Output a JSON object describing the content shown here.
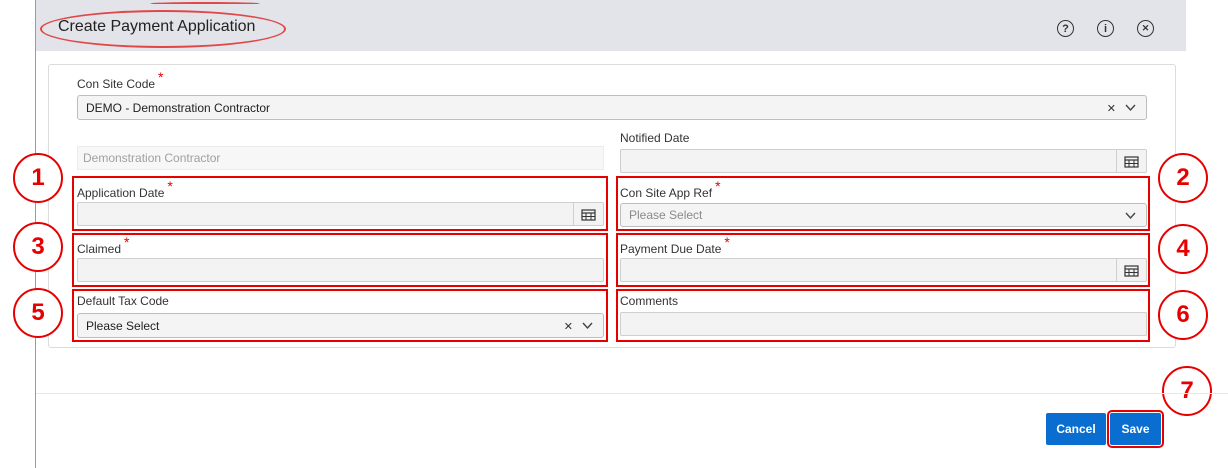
{
  "header": {
    "title": "Create Payment Application",
    "icons": [
      "help-icon",
      "info-icon",
      "close-icon"
    ],
    "help_glyph": "?",
    "info_glyph": "i",
    "close_glyph": "✕"
  },
  "form": {
    "con_site_code": {
      "label": "Con Site Code",
      "required": "*",
      "value": "DEMO - Demonstration Contractor"
    },
    "contractor_name": {
      "value": "Demonstration Contractor"
    },
    "notified_date": {
      "label": "Notified Date",
      "value": ""
    },
    "application_date": {
      "label": "Application Date",
      "required": "*",
      "value": ""
    },
    "con_site_app_ref": {
      "label": "Con Site App Ref",
      "required": "*",
      "placeholder": "Please Select"
    },
    "claimed": {
      "label": "Claimed",
      "required": "*",
      "value": ""
    },
    "payment_due_date": {
      "label": "Payment Due Date",
      "required": "*",
      "value": ""
    },
    "default_tax_code": {
      "label": "Default Tax Code",
      "value": "Please Select"
    },
    "comments": {
      "label": "Comments",
      "value": ""
    }
  },
  "annotations": {
    "n1": "1",
    "n2": "2",
    "n3": "3",
    "n4": "4",
    "n5": "5",
    "n6": "6",
    "n7": "7",
    "color": "#e60000"
  },
  "buttons": {
    "cancel": "Cancel",
    "save": "Save"
  },
  "colors": {
    "accent": "#0a6ed1",
    "header_bg": "#e3e3ea",
    "annotation": "#e60000"
  }
}
